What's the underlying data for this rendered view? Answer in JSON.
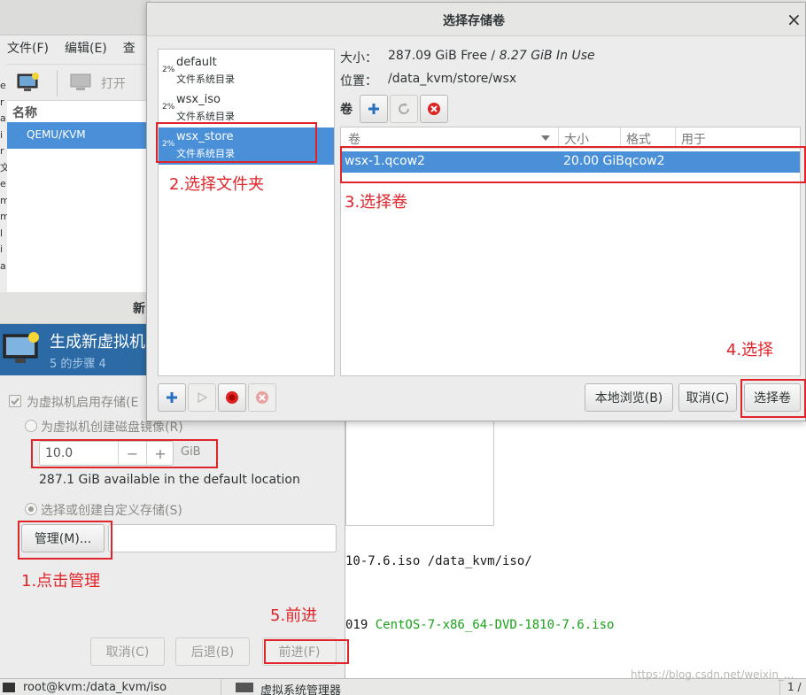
{
  "vmm": {
    "menus": [
      "文件(F)",
      "编辑(E)",
      "查"
    ],
    "open_label": "打开",
    "name_header": "名称",
    "connection": "QEMU/KVM",
    "left_letters": [
      "e",
      "r",
      "a",
      "i",
      "r",
      "文",
      "e",
      "m",
      "m",
      "l",
      "i",
      "a"
    ]
  },
  "wizard": {
    "title_partial": "新",
    "header_title": "生成新虚拟机",
    "header_step": "5 的步骤 4",
    "enable_storage": "为虚拟机启用存储(E",
    "create_image": "为虚拟机创建磁盘镜像(R)",
    "size_value": "10.0",
    "size_unit": "GiB",
    "minus": "−",
    "plus": "+",
    "available": "287.1 GiB available in the default location",
    "custom_storage": "选择或创建自定义存储(S)",
    "manage": "管理(M)...",
    "cancel": "取消(C)",
    "back": "后退(B)",
    "forward": "前进(F)"
  },
  "terminal": {
    "line1": "10-7.6.iso /data_kvm/iso/",
    "line2_prefix": "019 ",
    "line2_green": "CentOS-7-x86_64-DVD-1810-7.6.iso"
  },
  "taskbar": {
    "item1": "root@kvm:/data_kvm/iso",
    "item2": "虚拟系统管理器",
    "page": "1 /",
    "watermark": "https://blog.csdn.net/weixin_..."
  },
  "dialog": {
    "title": "选择存储卷",
    "close": "×",
    "pools": [
      {
        "pct": "2%",
        "name": "default",
        "type": "文件系统目录"
      },
      {
        "pct": "2%",
        "name": "wsx_iso",
        "type": "文件系统目录"
      },
      {
        "pct": "2%",
        "name": "wsx_store",
        "type": "文件系统目录"
      }
    ],
    "size_label": "大小：",
    "size_free": "287.09 GiB Free",
    "size_sep": " / ",
    "size_used": "8.27 GiB In Use",
    "loc_label": "位置：",
    "loc_value": "/data_kvm/store/wsx",
    "vol_label": "卷",
    "columns": [
      "卷",
      "大小",
      "格式",
      "用于"
    ],
    "rows": [
      {
        "name": "wsx-1.qcow2",
        "size": "20.00 GiB",
        "format": "qcow2",
        "used": ""
      }
    ],
    "browse": "本地浏览(B)",
    "cancel": "取消(C)",
    "choose": "选择卷"
  },
  "annotations": {
    "a1": "1.点击管理",
    "a2": "2.选择文件夹",
    "a3": "3.选择卷",
    "a4": "4.选择",
    "a5": "5.前进"
  },
  "colors": {
    "selection": "#4a90d9",
    "annotation_red": "#e0242a",
    "terminal_green": "#1aa31a",
    "wizard_header": "#2b6aa5"
  }
}
